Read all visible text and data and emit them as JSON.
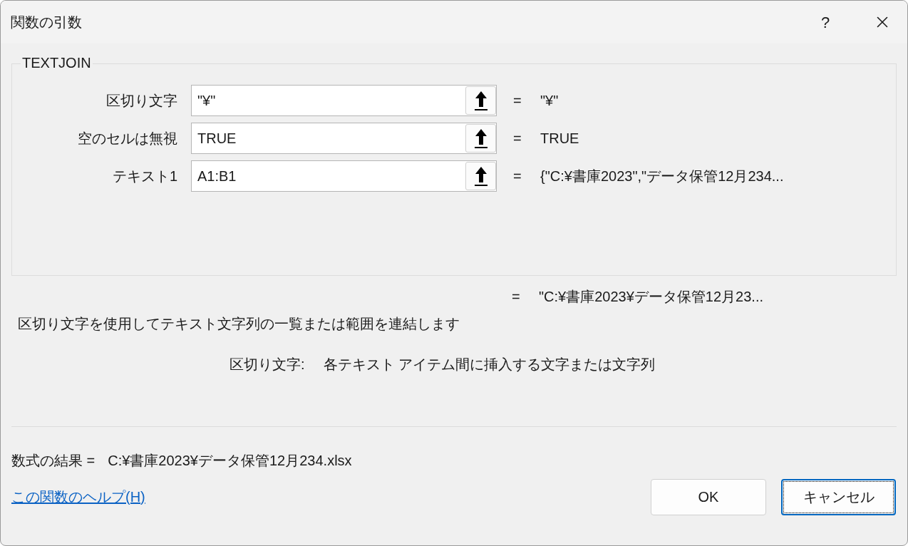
{
  "window": {
    "title": "関数の引数",
    "help": "?"
  },
  "function_name": "TEXTJOIN",
  "arguments": [
    {
      "label": "区切り文字",
      "value": "\"¥\"",
      "equals": "=",
      "result": "\"¥\""
    },
    {
      "label": "空のセルは無視",
      "value": "TRUE",
      "equals": "=",
      "result": "TRUE"
    },
    {
      "label": "テキスト1",
      "value": "A1:B1",
      "equals": "=",
      "result": "{\"C:¥書庫2023\",\"データ保管12月234..."
    }
  ],
  "function_result": {
    "equals": "=",
    "value": "\"C:¥書庫2023¥データ保管12月23..."
  },
  "description": "区切り文字を使用してテキスト文字列の一覧または範囲を連結します",
  "argument_help": {
    "label": "区切り文字:",
    "text": "各テキスト アイテム間に挿入する文字または文字列"
  },
  "formula_result": {
    "label": "数式の結果 =",
    "value": "C:¥書庫2023¥データ保管12月234.xlsx"
  },
  "help_link": "この関数のヘルプ(H)",
  "buttons": [
    {
      "label": "OK",
      "focused": false
    },
    {
      "label": "キャンセル",
      "focused": true
    }
  ]
}
